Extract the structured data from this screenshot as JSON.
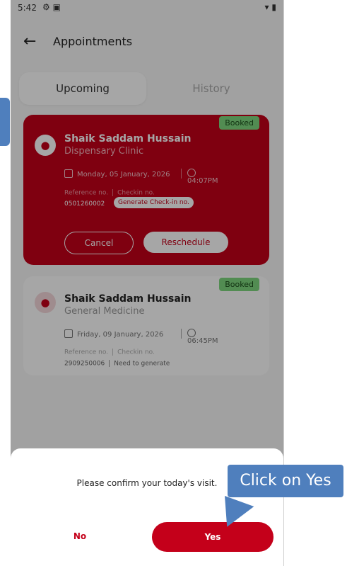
{
  "status_bar": {
    "time": "5:42"
  },
  "header": {
    "title": "Appointments"
  },
  "tabs": [
    {
      "label": "Upcoming"
    },
    {
      "label": "History"
    }
  ],
  "appointments": [
    {
      "status": "Booked",
      "doctor": "Shaik Saddam Hussain",
      "department": "Dispensary Clinic",
      "date": "Monday, 05 January, 2026",
      "time": "04:07PM",
      "reference_label": "Reference no.",
      "checkin_label": "Checkin no.",
      "reference_no": "0501260002",
      "generate_label": "Generate Check-in no.",
      "cancel_label": "Cancel",
      "reschedule_label": "Reschedule"
    },
    {
      "status": "Booked",
      "doctor": "Shaik Saddam Hussain",
      "department": "General Medicine",
      "date": "Friday, 09 January, 2026",
      "time": "06:45PM",
      "reference_label": "Reference no.",
      "checkin_label": "Checkin no.",
      "reference_no": "2909250006",
      "checkin_value": "Need to generate"
    }
  ],
  "dialog": {
    "message": "Please confirm your today's visit.",
    "no_label": "No",
    "yes_label": "Yes"
  },
  "callout": {
    "text": "Click on Yes"
  },
  "colors": {
    "brand": "#c4001a",
    "badge": "#7ed77e",
    "callout": "#4f7fbd"
  }
}
